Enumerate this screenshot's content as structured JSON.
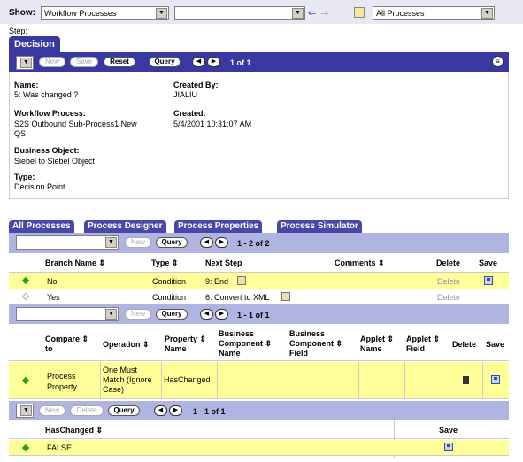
{
  "toolbar": {
    "show_label": "Show:",
    "show_value": "Workflow Processes",
    "filter_value": "",
    "scope_value": "All Processes"
  },
  "step_label": "Step:",
  "decision": {
    "title": "Decision",
    "new": "New",
    "save": "Save",
    "reset": "Reset",
    "query": "Query",
    "count": "1 of 1",
    "name_label": "Name:",
    "name_value": "5: Was changed ?",
    "created_by_label": "Created By:",
    "created_by_value": "JIALIU",
    "workflow_label": "Workflow Process:",
    "workflow_value_1": "S2S Outbound Sub-Process1 New",
    "workflow_value_2": "QS",
    "created_label": "Created:",
    "created_value": "5/4/2001 10:31:07 AM",
    "bo_label": "Business Object:",
    "bo_value": "Siebel to Siebel Object",
    "type_label": "Type:",
    "type_value": "Decision Point"
  },
  "tabs": [
    "All Processes",
    "Process Designer",
    "Process Properties",
    "Process Simulator"
  ],
  "branch": {
    "new": "New",
    "query": "Query",
    "count": "1 - 2 of 2",
    "headers": {
      "name": "Branch Name",
      "type": "Type",
      "next": "Next Step",
      "comments": "Comments",
      "delete": "Delete",
      "save": "Save"
    },
    "rows": [
      {
        "name": "No",
        "type": "Condition",
        "next": "9: End",
        "delete": "Delete"
      },
      {
        "name": "Yes",
        "type": "Condition",
        "next": "6: Convert to XML",
        "delete": "Delete"
      }
    ]
  },
  "criteria": {
    "new": "New",
    "query": "Query",
    "count": "1 - 1 of 1",
    "headers": {
      "compare_1": "Compare",
      "compare_2": "to",
      "operation": "Operation",
      "property_1": "Property",
      "property_2": "Name",
      "bc_name_1": "Business",
      "bc_name_2": "Component",
      "bc_name_3": "Name",
      "bc_field_1": "Business",
      "bc_field_2": "Component",
      "bc_field_3": "Field",
      "applet_name_1": "Applet",
      "applet_name_2": "Name",
      "applet_field_1": "Applet",
      "applet_field_2": "Field",
      "delete": "Delete",
      "save": "Save"
    },
    "row": {
      "compare_1": "Process",
      "compare_2": "Property",
      "op_1": "One Must",
      "op_2": "Match (Ignore",
      "op_3": "Case)",
      "property": "HasChanged"
    }
  },
  "values": {
    "new": "New",
    "delete": "Delete",
    "query": "Query",
    "count": "1 - 1 of 1",
    "header": "HasChanged",
    "save_header": "Save",
    "row_value": "FALSE"
  }
}
